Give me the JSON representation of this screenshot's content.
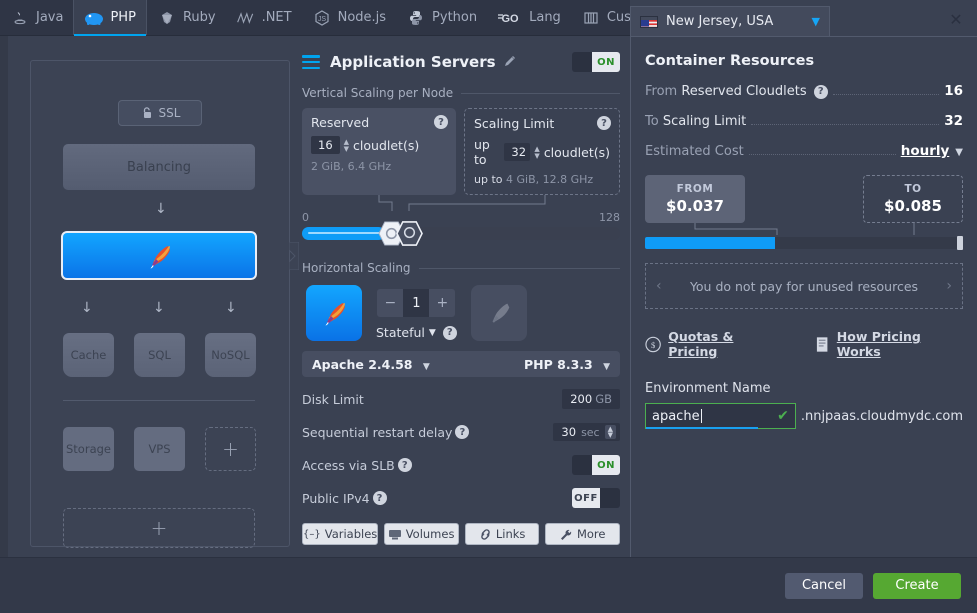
{
  "tabs": [
    {
      "label": "Java",
      "icon": "java-icon",
      "active": false
    },
    {
      "label": "PHP",
      "icon": "php-icon",
      "active": true
    },
    {
      "label": "Ruby",
      "icon": "ruby-icon",
      "active": false
    },
    {
      "label": ".NET",
      "icon": "dotnet-icon",
      "active": false
    },
    {
      "label": "Node.js",
      "icon": "nodejs-icon",
      "active": false
    },
    {
      "label": "Python",
      "icon": "python-icon",
      "active": false
    },
    {
      "label": "Lang",
      "icon": "go-icon",
      "active": false
    },
    {
      "label": "Custom",
      "icon": "custom-icon",
      "active": false
    }
  ],
  "tab_more_caret": "▼",
  "topology": {
    "ssl_label": "SSL",
    "balancing_label": "Balancing",
    "db_nodes": [
      "Cache",
      "SQL",
      "NoSQL"
    ],
    "extra_nodes": [
      "Storage",
      "VPS"
    ],
    "plus_label": "+"
  },
  "middle": {
    "title": "Application Servers",
    "toggle": "ON",
    "vertical_section": "Vertical Scaling per Node",
    "reserved": {
      "title": "Reserved",
      "value": "16",
      "unit": "cloudlet(s)",
      "sub": "2 GiB, 6.4 GHz",
      "help": "?"
    },
    "scaling_limit": {
      "title": "Scaling Limit",
      "prefix": "up to",
      "value": "32",
      "unit": "cloudlet(s)",
      "sub_prefix": "up to",
      "sub": "4 GiB, 12.8 GHz",
      "help": "?"
    },
    "slider": {
      "min": "0",
      "max": "128"
    },
    "horizontal_section": "Horizontal Scaling",
    "node_count": "1",
    "minus": "−",
    "plus": "+",
    "stateful_label": "Stateful",
    "stack_left": "Apache 2.4.58",
    "stack_right": "PHP 8.3.3",
    "options": [
      {
        "label": "Disk Limit",
        "value": "200",
        "unit": "GB",
        "type": "limit",
        "help": false
      },
      {
        "label": "Sequential restart delay",
        "value": "30",
        "unit": "sec",
        "type": "spinner",
        "help": true
      },
      {
        "label": "Access via SLB",
        "value": "ON",
        "type": "toggle-on",
        "help": true
      },
      {
        "label": "Public IPv4",
        "value": "OFF",
        "type": "toggle-off",
        "help": true
      }
    ],
    "chips": [
      {
        "label": "Variables",
        "icon": "braces-icon"
      },
      {
        "label": "Volumes",
        "icon": "volume-icon"
      },
      {
        "label": "Links",
        "icon": "link-icon"
      },
      {
        "label": "More",
        "icon": "wrench-icon"
      }
    ]
  },
  "right": {
    "region": "New Jersey, USA",
    "region_caret": "▼",
    "close": "✕",
    "title": "Container Resources",
    "rows": [
      {
        "label_prefix": "From ",
        "label": "Reserved Cloudlets",
        "help": true,
        "value": "16"
      },
      {
        "label_prefix": "To ",
        "label": "Scaling Limit",
        "help": false,
        "value": "32"
      },
      {
        "label_prefix": "",
        "label": "Estimated Cost",
        "help": false,
        "value": "hourly",
        "is_link": true,
        "caret": "▼"
      }
    ],
    "cost_from_cap": "FROM",
    "cost_from": "$0.037",
    "cost_to_cap": "TO",
    "cost_to": "$0.085",
    "note": "You do not pay for unused resources",
    "note_prev": "‹",
    "note_next": "›",
    "links": [
      {
        "label": "Quotas & Pricing",
        "icon": "dollar-icon"
      },
      {
        "label": "How Pricing Works",
        "icon": "document-icon"
      }
    ],
    "env_label": "Environment Name",
    "env_value": "apache",
    "env_check": "✔",
    "env_suffix": ".nnjpaas.cloudmydc.com"
  },
  "footer": {
    "cancel": "Cancel",
    "create": "Create"
  },
  "colors": {
    "accent": "#00a4ef",
    "create_green": "#56a832",
    "panel_bg": "#3a4152",
    "tabbar_bg": "#2f3545"
  }
}
